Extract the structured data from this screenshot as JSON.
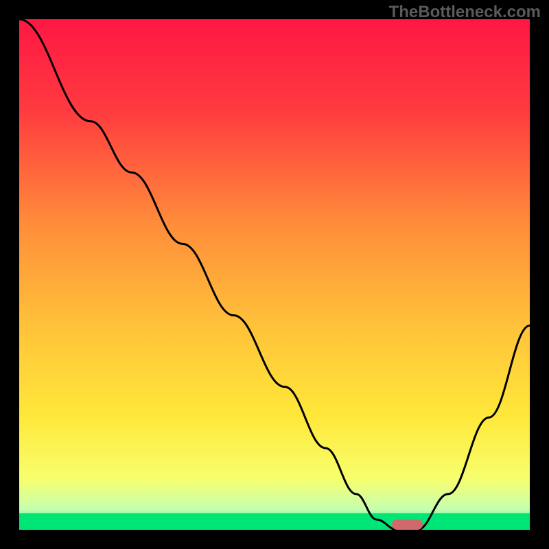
{
  "watermark": "TheBottleneck.com",
  "chart_data": {
    "type": "line",
    "title": "",
    "xlabel": "",
    "ylabel": "",
    "xlim": [
      0,
      100
    ],
    "ylim": [
      0,
      100
    ],
    "series": [
      {
        "name": "bottleneck-curve",
        "x": [
          0,
          14,
          22,
          32,
          42,
          52,
          60,
          66,
          70,
          74,
          78,
          84,
          92,
          100
        ],
        "values": [
          100,
          80,
          70,
          56,
          42,
          28,
          16,
          7,
          2,
          0,
          0,
          7,
          22,
          40
        ]
      }
    ],
    "marker": {
      "x": 76,
      "y": 1,
      "width": 6,
      "height": 2
    },
    "gradient_stops": [
      {
        "offset": 0,
        "color": "#ff1744"
      },
      {
        "offset": 18,
        "color": "#ff3b3f"
      },
      {
        "offset": 40,
        "color": "#ff8c3a"
      },
      {
        "offset": 60,
        "color": "#ffc23a"
      },
      {
        "offset": 78,
        "color": "#ffe83a"
      },
      {
        "offset": 90,
        "color": "#f7ff6e"
      },
      {
        "offset": 96,
        "color": "#c6ffb0"
      },
      {
        "offset": 100,
        "color": "#00e676"
      }
    ],
    "green_band_height_pct": 3.2
  }
}
